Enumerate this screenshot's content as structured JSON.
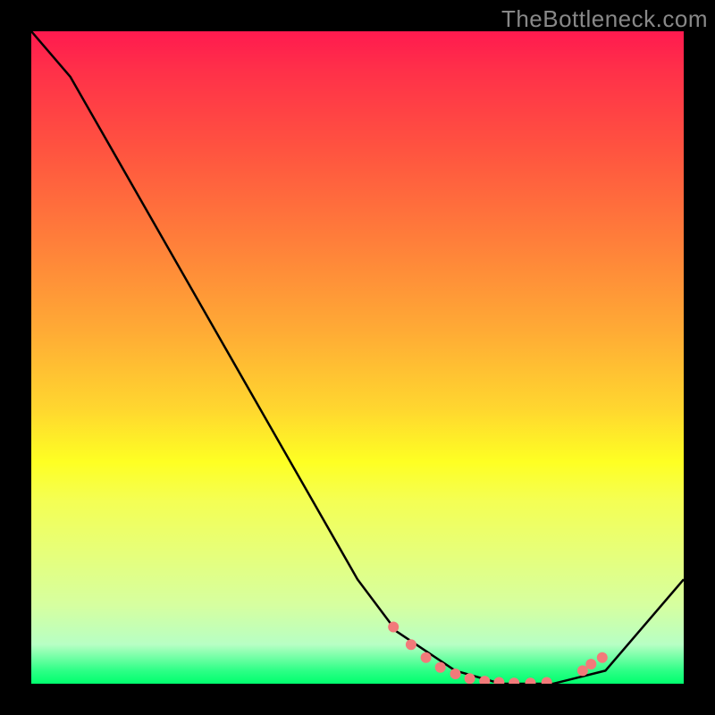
{
  "watermark": "TheBottleneck.com",
  "chart_data": {
    "type": "line",
    "title": "",
    "xlabel": "",
    "ylabel": "",
    "x": [
      0.0,
      0.06,
      0.5,
      0.56,
      0.65,
      0.72,
      0.8,
      0.88,
      1.0
    ],
    "values": [
      1.0,
      0.93,
      0.16,
      0.08,
      0.02,
      0.0,
      0.0,
      0.02,
      0.16
    ],
    "xlim": [
      0,
      1
    ],
    "ylim": [
      0,
      1
    ],
    "markers": {
      "x": [
        0.555,
        0.582,
        0.605,
        0.627,
        0.65,
        0.672,
        0.695,
        0.717,
        0.74,
        0.765,
        0.79,
        0.845,
        0.858,
        0.875
      ],
      "y": [
        0.087,
        0.06,
        0.04,
        0.025,
        0.015,
        0.008,
        0.004,
        0.002,
        0.001,
        0.001,
        0.002,
        0.02,
        0.03,
        0.04
      ]
    },
    "colors": {
      "gradient_top": "#ff1a4f",
      "gradient_mid": "#feff23",
      "gradient_bottom": "#00ff6e",
      "line": "#000000",
      "marker": "#f27a7a"
    }
  }
}
